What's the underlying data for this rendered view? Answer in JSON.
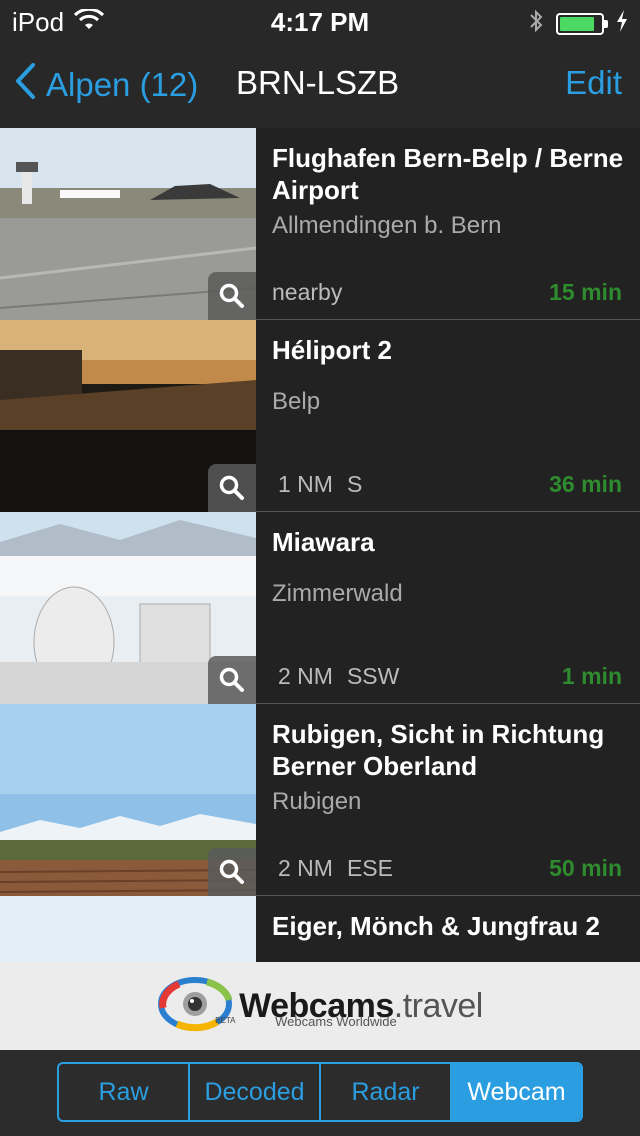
{
  "status_bar": {
    "carrier": "iPod",
    "time": "4:17 PM",
    "battery_level": 0.85,
    "battery_color": "#4cd964"
  },
  "nav": {
    "back_label": "Alpen (12)",
    "title": "BRN-LSZB",
    "edit_label": "Edit",
    "accent_color": "#2a9ee0"
  },
  "webcams": [
    {
      "title": "Flughafen Bern-Belp / Berne Airport",
      "location": "Allmendingen b. Bern",
      "distance": "nearby",
      "direction": "",
      "age": "15 min",
      "scene": "airport"
    },
    {
      "title": "Héliport 2",
      "location": "Belp",
      "distance": "1 NM",
      "direction": "S",
      "age": "36 min",
      "scene": "dusk"
    },
    {
      "title": "Miawara",
      "location": "Zimmerwald",
      "distance": "2 NM",
      "direction": "SSW",
      "age": "1 min",
      "scene": "snow"
    },
    {
      "title": "Rubigen, Sicht in Richtung Berner Oberland",
      "location": "Rubigen",
      "distance": "2 NM",
      "direction": "ESE",
      "age": "50 min",
      "scene": "field"
    },
    {
      "title": "Eiger, Mönch & Jungfrau 2",
      "location": "",
      "distance": "",
      "direction": "",
      "age": "",
      "scene": "sky"
    }
  ],
  "ad": {
    "brand_main": "Webcams",
    "brand_suffix": ".travel",
    "tagline": "Webcams Worldwide",
    "beta": "BETA"
  },
  "tabs": [
    {
      "label": "Raw",
      "active": false
    },
    {
      "label": "Decoded",
      "active": false
    },
    {
      "label": "Radar",
      "active": false
    },
    {
      "label": "Webcam",
      "active": true
    }
  ]
}
